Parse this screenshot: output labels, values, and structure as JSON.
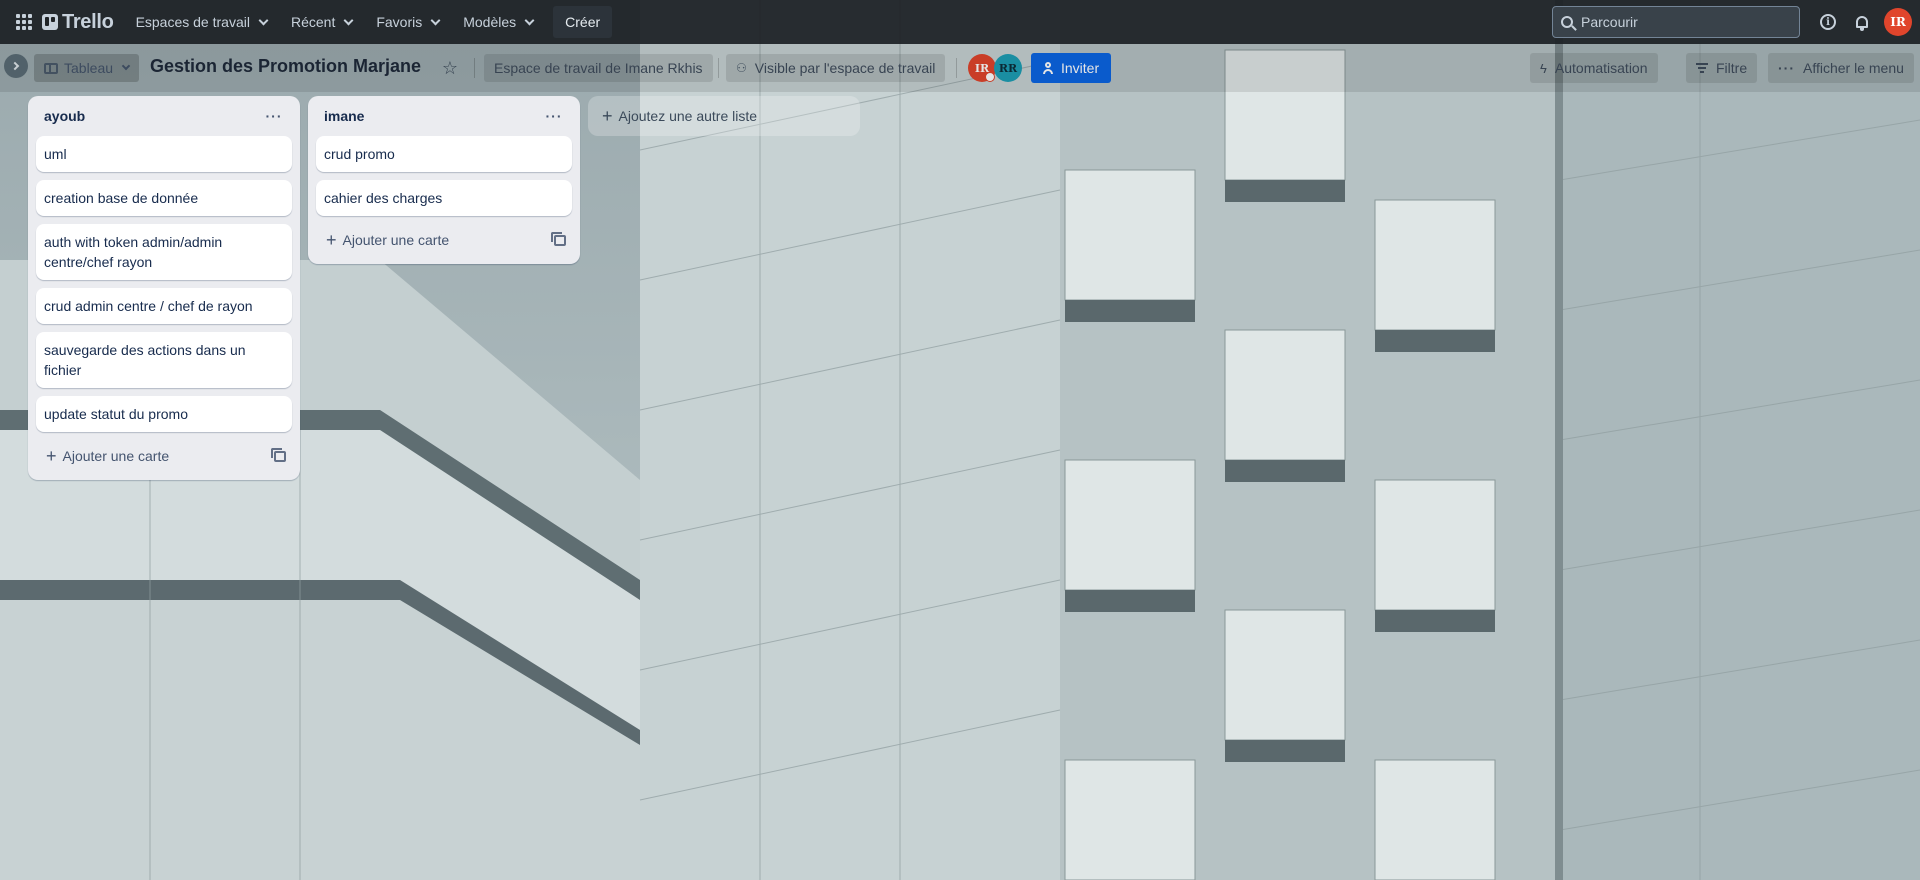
{
  "topnav": {
    "logo": "Trello",
    "items": [
      {
        "label": "Espaces de travail"
      },
      {
        "label": "Récent"
      },
      {
        "label": "Favoris"
      },
      {
        "label": "Modèles"
      }
    ],
    "create_label": "Créer",
    "search_placeholder": "Parcourir",
    "avatar_initials": "IR"
  },
  "board": {
    "view_label": "Tableau",
    "title": "Gestion des Promotion Marjane",
    "workspace_label": "Espace de travail de Imane Rkhis",
    "visibility_label": "Visible par l'espace de travail",
    "members": [
      "IR",
      "RR"
    ],
    "invite_label": "Inviter",
    "automation_label": "Automatisation",
    "filter_label": "Filtre",
    "menu_label": "Afficher le menu"
  },
  "lists": [
    {
      "title": "ayoub",
      "cards": [
        "uml",
        "creation base de donnée",
        "auth with token admin/admin centre/chef rayon",
        "crud admin centre / chef de rayon",
        "sauvegarde des actions dans un fichier",
        "update statut du promo"
      ],
      "add_card_label": "Ajouter une carte"
    },
    {
      "title": "imane",
      "cards": [
        "crud promo",
        "cahier des charges"
      ],
      "add_card_label": "Ajouter une carte"
    }
  ],
  "add_list_label": "Ajoutez une autre liste",
  "colors": {
    "nav_bg": "#1d2125",
    "invite_blue": "#0c66e4",
    "avatar_ir": "#e0452c",
    "avatar_rr": "#1d9fb5",
    "list_bg": "#ebecf0"
  },
  "icons": [
    "app-switcher-icon",
    "chevron-down-icon",
    "search-icon",
    "info-icon",
    "bell-icon",
    "star-icon",
    "board-icon",
    "lock-icon",
    "bolt-icon",
    "filter-icon",
    "more-icon",
    "plus-icon",
    "template-icon",
    "person-add-icon"
  ]
}
